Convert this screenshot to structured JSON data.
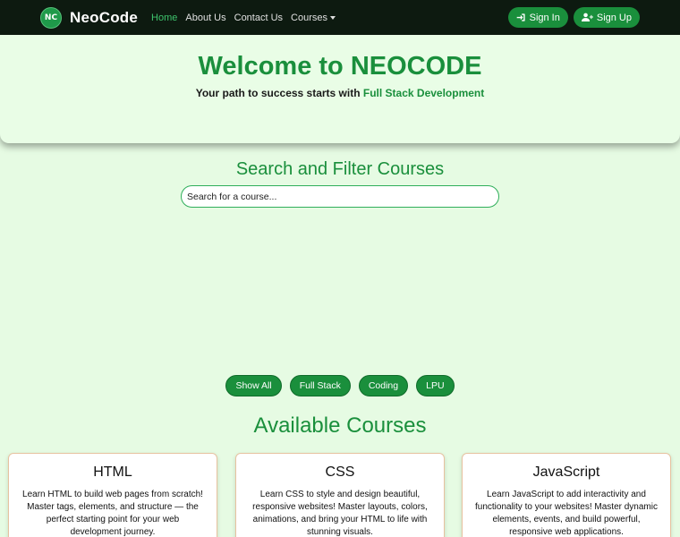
{
  "navbar": {
    "logo_text": "NC",
    "brand": "NeoCode",
    "links": [
      "Home",
      "About Us",
      "Contact Us",
      "Courses"
    ],
    "sign_in": "Sign In",
    "sign_up": "Sign Up"
  },
  "hero": {
    "title": "Welcome to NEOCODE",
    "subtitle_prefix": "Your path to success starts with ",
    "subtitle_highlight": "Full Stack Development"
  },
  "search": {
    "title": "Search and Filter Courses",
    "placeholder": "Search for a course...",
    "value": ""
  },
  "filters": [
    "Show All",
    "Full Stack",
    "Coding",
    "LPU"
  ],
  "courses": {
    "title": "Available Courses",
    "items": [
      {
        "name": "HTML",
        "desc": "Learn HTML to build web pages from scratch! Master tags, elements, and structure — the perfect starting point for your web development journey."
      },
      {
        "name": "CSS",
        "desc": "Learn CSS to style and design beautiful, responsive websites! Master layouts, colors, animations, and bring your HTML to life with stunning visuals."
      },
      {
        "name": "JavaScript",
        "desc": "Learn JavaScript to add interactivity and functionality to your websites! Master dynamic elements, events, and build powerful, responsive web applications."
      }
    ]
  },
  "colors": {
    "accent": "#1a8f3c",
    "navbar_bg": "#0d1a10",
    "page_bg": "#e6fbe3"
  }
}
